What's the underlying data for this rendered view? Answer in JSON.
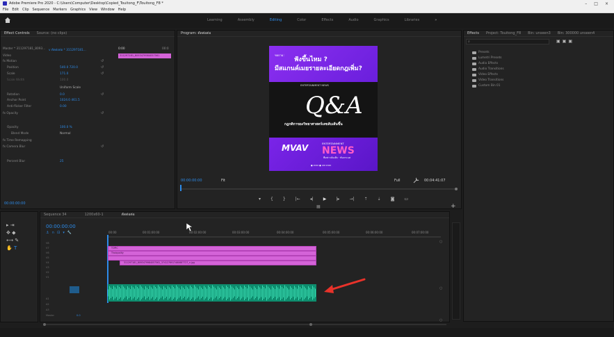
{
  "window": {
    "title": "Adobe Premiere Pro 2020 - C:\\Users\\Computer\\Desktop\\Copied_Touitong_F\\Touitong_F8 *",
    "controls": [
      "–",
      "□",
      "×"
    ]
  },
  "menu": [
    "File",
    "Edit",
    "Clip",
    "Sequence",
    "Markers",
    "Graphics",
    "View",
    "Window",
    "Help"
  ],
  "workspaces": {
    "items": [
      "Learning",
      "Assembly",
      "Editing",
      "Color",
      "Effects",
      "Audio",
      "Graphics",
      "Libraries"
    ],
    "active": "Editing",
    "more": "»"
  },
  "effect_controls": {
    "tab_active": "Effect Controls",
    "tab_other": "Source: (no clips)",
    "master": "Master * 311297181_8093...",
    "sequence": "v  ตัดต่อต่อ * 311297181...",
    "time_start": "0:00",
    "time_end": "00:0",
    "clip_label": "311297181_8093479984057561",
    "rows": [
      {
        "label": "Video",
        "value": ""
      },
      {
        "label": "fx  Motion",
        "value": ""
      },
      {
        "label": "Position",
        "value": "540.0   720.0"
      },
      {
        "label": "Scale",
        "value": "171.0"
      },
      {
        "label": "Scale Width",
        "value": "100.0"
      },
      {
        "label": "",
        "value": "Uniform Scale"
      },
      {
        "label": "Rotation",
        "value": "0.0"
      },
      {
        "label": "Anchor Point",
        "value": "1024.0   461.5"
      },
      {
        "label": "Anti-flicker Filter",
        "value": "0.00"
      },
      {
        "label": "fx  Opacity",
        "value": ""
      },
      {
        "label": "Opacity",
        "value": "100.0 %"
      },
      {
        "label": "Blend Mode",
        "value": "Normal"
      },
      {
        "label": "fx  Time Remapping",
        "value": ""
      },
      {
        "label": "fx  Camera Blur",
        "value": ""
      },
      {
        "label": "Percent Blur",
        "value": "25"
      }
    ],
    "timecode": "00:00:00:00"
  },
  "program": {
    "title": "Program: ตัดต่อต่อ",
    "video": {
      "small": "ขอถาม:",
      "headline1": "ฟังขึ้นไหม ?",
      "headline2": "มีสแกนค์เมยรายละเอียดกฎเพิ่ม?",
      "tag": "ENTERTAINMENT NEWS",
      "qa": "Q&A",
      "caption": "กฎกติกาของวิทยาศาสตร์เลขลับเส้นขึ้น",
      "logo": "MVAV",
      "ent": "ENTERTAINMENT",
      "news": "NEWS",
      "sub": "ทีมข่าวบันเทิง · ทันกระแส",
      "strip": "● 2020   ● เมษ  2020"
    },
    "timecode_left": "00:00:00:00",
    "fit": "Fit",
    "quality": "Full",
    "timecode_right": "00:04:41:07"
  },
  "project": {
    "tabs": [
      "Effects",
      "Project: Touitong_F8",
      "Bin: unseen3",
      "Bin: 300000 unseen4"
    ],
    "items": [
      "Presets",
      "Lumetri Presets",
      "Audio Effects",
      "Audio Transitions",
      "Video Effects",
      "Video Transitions",
      "Custom Bin 01"
    ]
  },
  "timeline": {
    "tabs": [
      "Sequence 34",
      "1200x60-1",
      "ตัดต่อต่อ"
    ],
    "timecode": "00:00:00:00",
    "ruler": [
      "00:00",
      "00:01:00:00",
      "00:02:00:00",
      "00:03:00:00",
      "00:04:00:00",
      "00:05:00:00",
      "00:06:00:00",
      "00:07:00:00"
    ],
    "tracks": [
      "V8",
      "V7",
      "V6",
      "V5",
      "V4",
      "V3",
      "V2",
      "V1",
      "A1",
      "A2",
      "A3",
      "Master"
    ],
    "master_value": "0.0",
    "clips": [
      {
        "label": "TOPIC"
      },
      {
        "label": "Thaiquality"
      },
      {
        "label": "311297181_8093479984057561_3741276917460687727_n.jpg"
      }
    ]
  },
  "colors": {
    "accent": "#2d8ceb",
    "clip_pink": "#d463d8",
    "audio_green": "#0e8d6e",
    "arrow": "#e8322a"
  }
}
